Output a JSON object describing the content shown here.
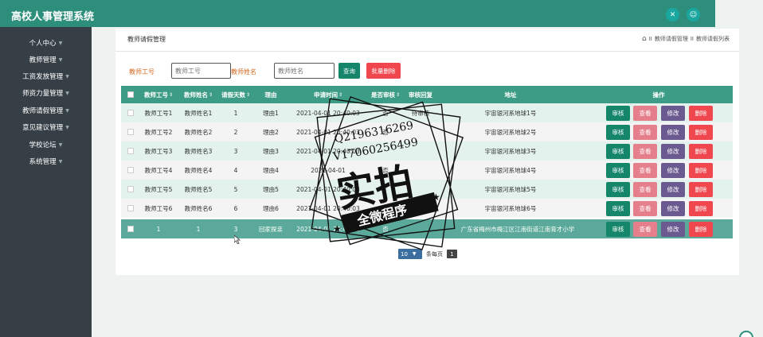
{
  "app": {
    "title": "高校人事管理系统"
  },
  "topbar": {
    "icons": [
      "crosshair-icon",
      "user-icon"
    ]
  },
  "sidebar": {
    "items": [
      {
        "label": "个人中心"
      },
      {
        "label": "教师管理"
      },
      {
        "label": "工资发放管理"
      },
      {
        "label": "师资力量管理"
      },
      {
        "label": "教师请假管理"
      },
      {
        "label": "意见建议管理"
      },
      {
        "label": "学校论坛"
      },
      {
        "label": "系统管理"
      }
    ]
  },
  "page": {
    "title": "教师请假管理",
    "breadcrumb": [
      "教师请假管理",
      "教师请假列表"
    ],
    "breadcrumb_sep": "II"
  },
  "filters": {
    "teacher_id_label": "教师工号",
    "teacher_id_placeholder": "教师工号",
    "teacher_name_label": "教师姓名",
    "teacher_name_placeholder": "教师姓名",
    "search_label": "查询",
    "batch_delete_label": "批量删除"
  },
  "table": {
    "columns": [
      "教师工号",
      "教师姓名",
      "请假天数",
      "理由",
      "申请时间",
      "是否审核",
      "审核回复",
      "地址",
      "操作"
    ],
    "rows": [
      {
        "id": "教师工号1",
        "name": "教师姓名1",
        "days": "1",
        "reason": "理由1",
        "time": "2021-04-01 20:40:03",
        "audited": "否",
        "reply": "待审核",
        "address": "宇宙银河系地球1号"
      },
      {
        "id": "教师工号2",
        "name": "教师姓名2",
        "days": "2",
        "reason": "理由2",
        "time": "2021-04-01 20:40:03",
        "audited": "否",
        "reply": "",
        "address": "宇宙银河系地球2号"
      },
      {
        "id": "教师工号3",
        "name": "教师姓名3",
        "days": "3",
        "reason": "理由3",
        "time": "2021-04-01 20:40:03",
        "audited": "",
        "reply": "",
        "address": "宇宙银河系地球3号"
      },
      {
        "id": "教师工号4",
        "name": "教师姓名4",
        "days": "4",
        "reason": "理由4",
        "time": "2021-04-01",
        "audited": "否",
        "reply": "",
        "address": "宇宙银河系地球4号"
      },
      {
        "id": "教师工号5",
        "name": "教师姓名5",
        "days": "5",
        "reason": "理由5",
        "time": "2021-04-01 20:40:03",
        "audited": "",
        "reply": "",
        "address": "宇宙银河系地球5号"
      },
      {
        "id": "教师工号6",
        "name": "教师姓名6",
        "days": "6",
        "reason": "理由6",
        "time": "2021-04-01 20:40:03",
        "audited": "",
        "reply": "",
        "address": "宇宙银河系地球6号"
      },
      {
        "id": "1",
        "name": "1",
        "days": "3",
        "reason": "回家探亲",
        "time": "2021-04-01 20:40:03",
        "audited": "否",
        "reply": "",
        "address": "广东省梅州市梅江区江南街道江南育才小学"
      }
    ],
    "actions": {
      "review": "审核",
      "view": "查看",
      "edit": "修改",
      "delete": "删除"
    }
  },
  "pager": {
    "page_size": "10",
    "per_page_label": "条每页",
    "current_page": "1"
  },
  "watermark": {
    "line1": "Q2196316269",
    "line2": "V17060256499",
    "big": "实拍",
    "ribbon": "全微程序"
  },
  "colors": {
    "topbar": "#2d8e7c",
    "sidebar": "#363f46",
    "table_header": "#3d9c85",
    "review_btn": "#16866a",
    "view_btn": "#e57f8c",
    "edit_btn": "#6a5a8f",
    "delete_btn": "#f0474f"
  }
}
